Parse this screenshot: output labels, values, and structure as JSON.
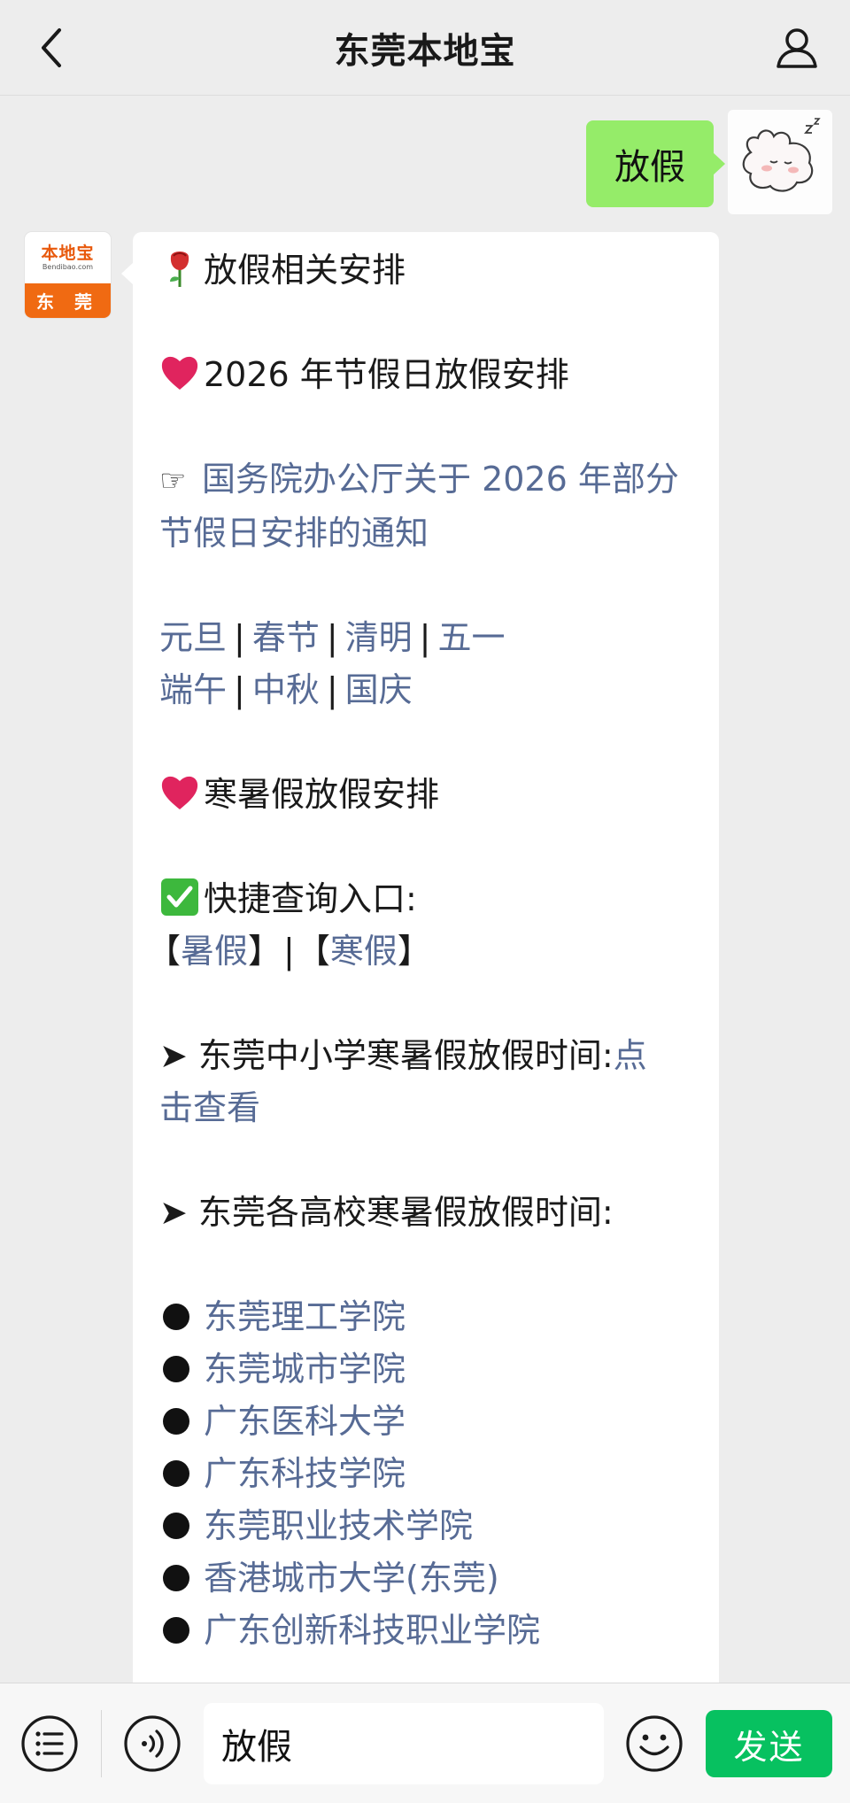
{
  "header": {
    "title": "东莞本地宝",
    "back_icon": "chevron-left-icon",
    "profile_icon": "user-icon"
  },
  "user_message": {
    "text": "放假"
  },
  "bot": {
    "avatar": {
      "brand": "本地宝",
      "url": "Bendibao.com",
      "city": "东 莞"
    },
    "lines": {
      "heading": "放假相关安排",
      "holiday_2026": "2026 年节假日放假安排",
      "notice_line1": "国务院办公厅关于 2026 年部分",
      "notice_line2": "节假日安排的通知",
      "festivals_row1": [
        "元旦",
        "春节",
        "清明",
        "五一"
      ],
      "festivals_row2": [
        "端午",
        "中秋",
        "国庆"
      ],
      "vacation": "寒暑假放假安排",
      "quick_entry": "快捷查询入口:",
      "summer": "暑假",
      "winter": "寒假",
      "bracket_open": "【",
      "bracket_close": "】",
      "bar": "|",
      "school_time": "东莞中小学寒暑假放假时间:",
      "school_link_a": "点",
      "school_link_b": "击查看",
      "univ_time": "东莞各高校寒暑假放假时间:",
      "universities": [
        "东莞理工学院",
        "东莞城市学院",
        "广东医科大学",
        "广东科技学院",
        "东莞职业技术学院",
        "香港城市大学(东莞)",
        "广东创新科技职业学院"
      ]
    }
  },
  "toolbar": {
    "input_value": "放假",
    "send_label": "发送",
    "menu_icon": "list-icon",
    "voice_icon": "voice-icon",
    "emoji_icon": "smiley-icon"
  },
  "colors": {
    "link": "#576b95",
    "user_bubble": "#95ec69",
    "send_button": "#07c160",
    "brand_orange": "#f06a12"
  }
}
